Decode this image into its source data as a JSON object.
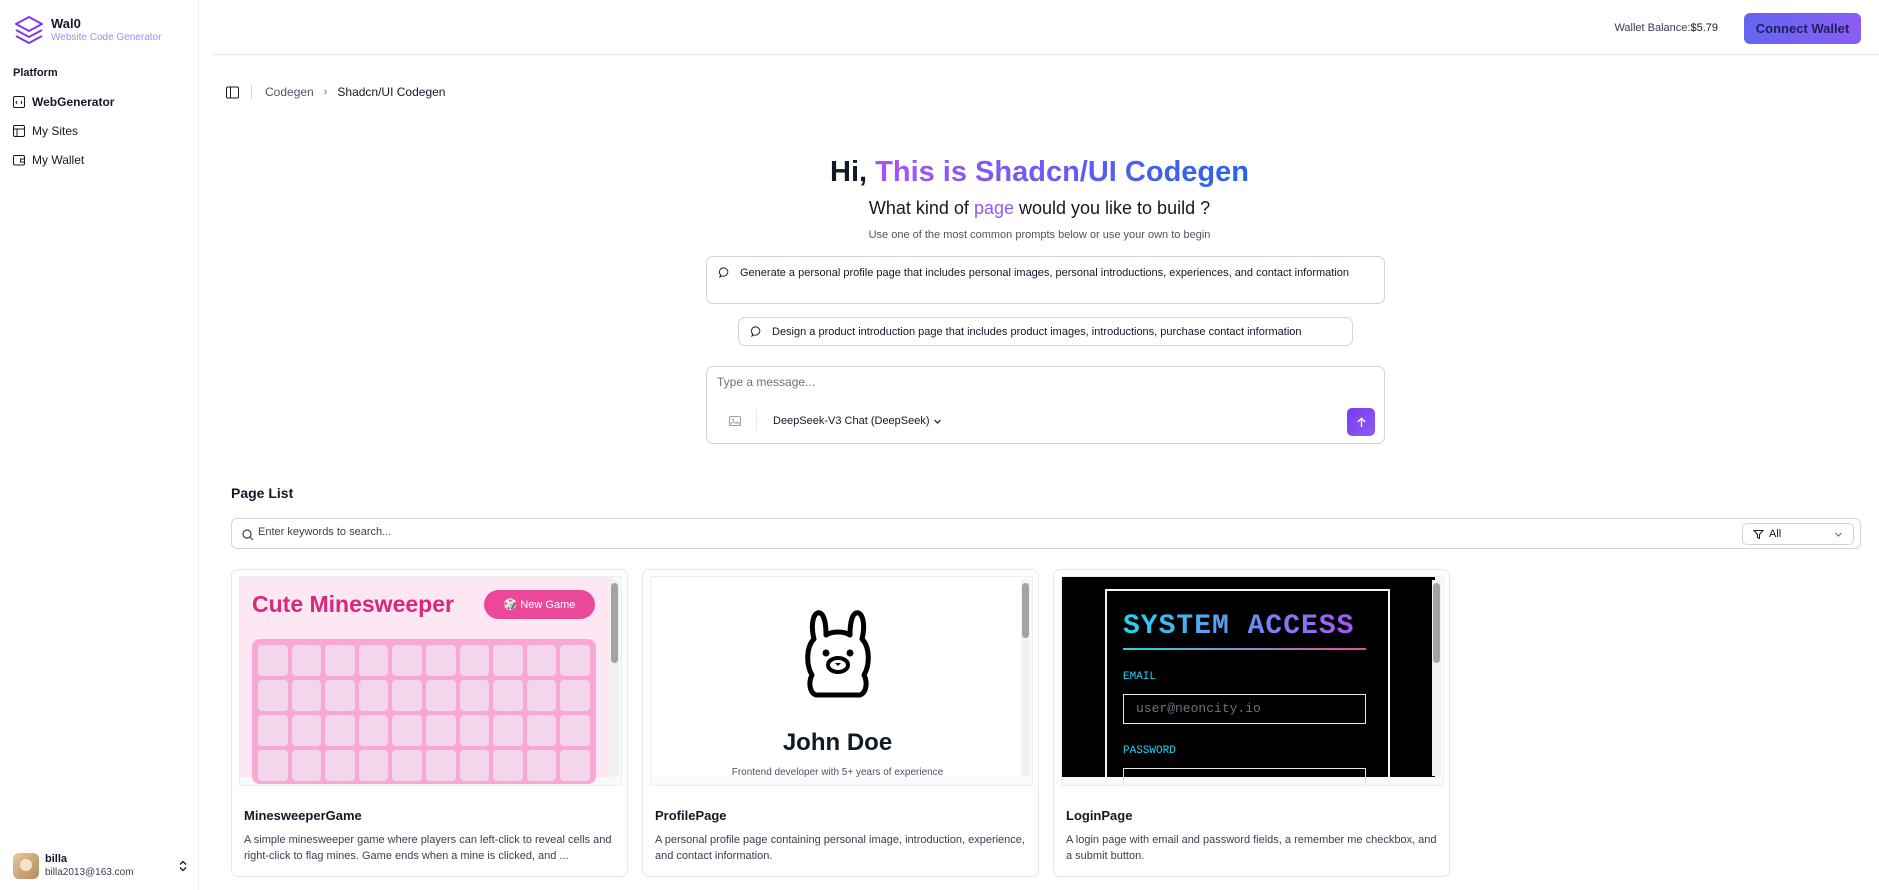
{
  "brand": {
    "name": "Wal0",
    "subtitle": "Website Code Generator"
  },
  "sidebar": {
    "section_label": "Platform",
    "items": [
      {
        "label": "WebGenerator",
        "icon": "code-window-icon"
      },
      {
        "label": "My Sites",
        "icon": "layout-icon"
      },
      {
        "label": "My Wallet",
        "icon": "wallet-icon"
      }
    ]
  },
  "user": {
    "name": "billa",
    "email": "billa2013@163.com"
  },
  "header": {
    "wallet_label": "Wallet Balance:",
    "wallet_amount": "$5.79",
    "connect_label": "Connect Wallet"
  },
  "breadcrumb": {
    "parent": "Codegen",
    "current": "Shadcn/UI Codegen"
  },
  "hero": {
    "greeting": "Hi, ",
    "title_highlight": "This is Shadcn/UI Codegen",
    "question_before": "What kind of ",
    "question_accent": "page",
    "question_after": " would you like to build ?",
    "hint": "Use one of the most common prompts below or use your own to begin"
  },
  "prompts": [
    "Generate a personal profile page that includes personal images, personal introductions, experiences, and contact information",
    "Design a product introduction page that includes product images, introductions, purchase contact information"
  ],
  "composer": {
    "placeholder": "Type a message...",
    "model": "DeepSeek-V3 Chat (DeepSeek)"
  },
  "page_list": {
    "title": "Page List",
    "search_placeholder": "Enter keywords to search...",
    "filter_value": "All",
    "cards": [
      {
        "title": "MinesweeperGame",
        "description": "A simple minesweeper game where players can left-click to reveal cells and right-click to flag mines. Game ends when a mine is clicked, and ...",
        "preview": {
          "heading": "Cute Minesweeper",
          "button": "🎲 New Game"
        }
      },
      {
        "title": "ProfilePage",
        "description": "A personal profile page containing personal image, introduction, experience, and contact information.",
        "preview": {
          "name": "John Doe",
          "sub": "Frontend developer with 5+ years of experience"
        }
      },
      {
        "title": "LoginPage",
        "description": "A login page with email and password fields, a remember me checkbox, and a submit button.",
        "preview": {
          "heading": "SYSTEM ACCESS",
          "email_label": "EMAIL",
          "email_placeholder": "user@neoncity.io",
          "password_label": "PASSWORD"
        }
      }
    ]
  },
  "colors": {
    "accent_start": "#a855f7",
    "accent_end": "#2563eb",
    "button": "#6366f1"
  }
}
